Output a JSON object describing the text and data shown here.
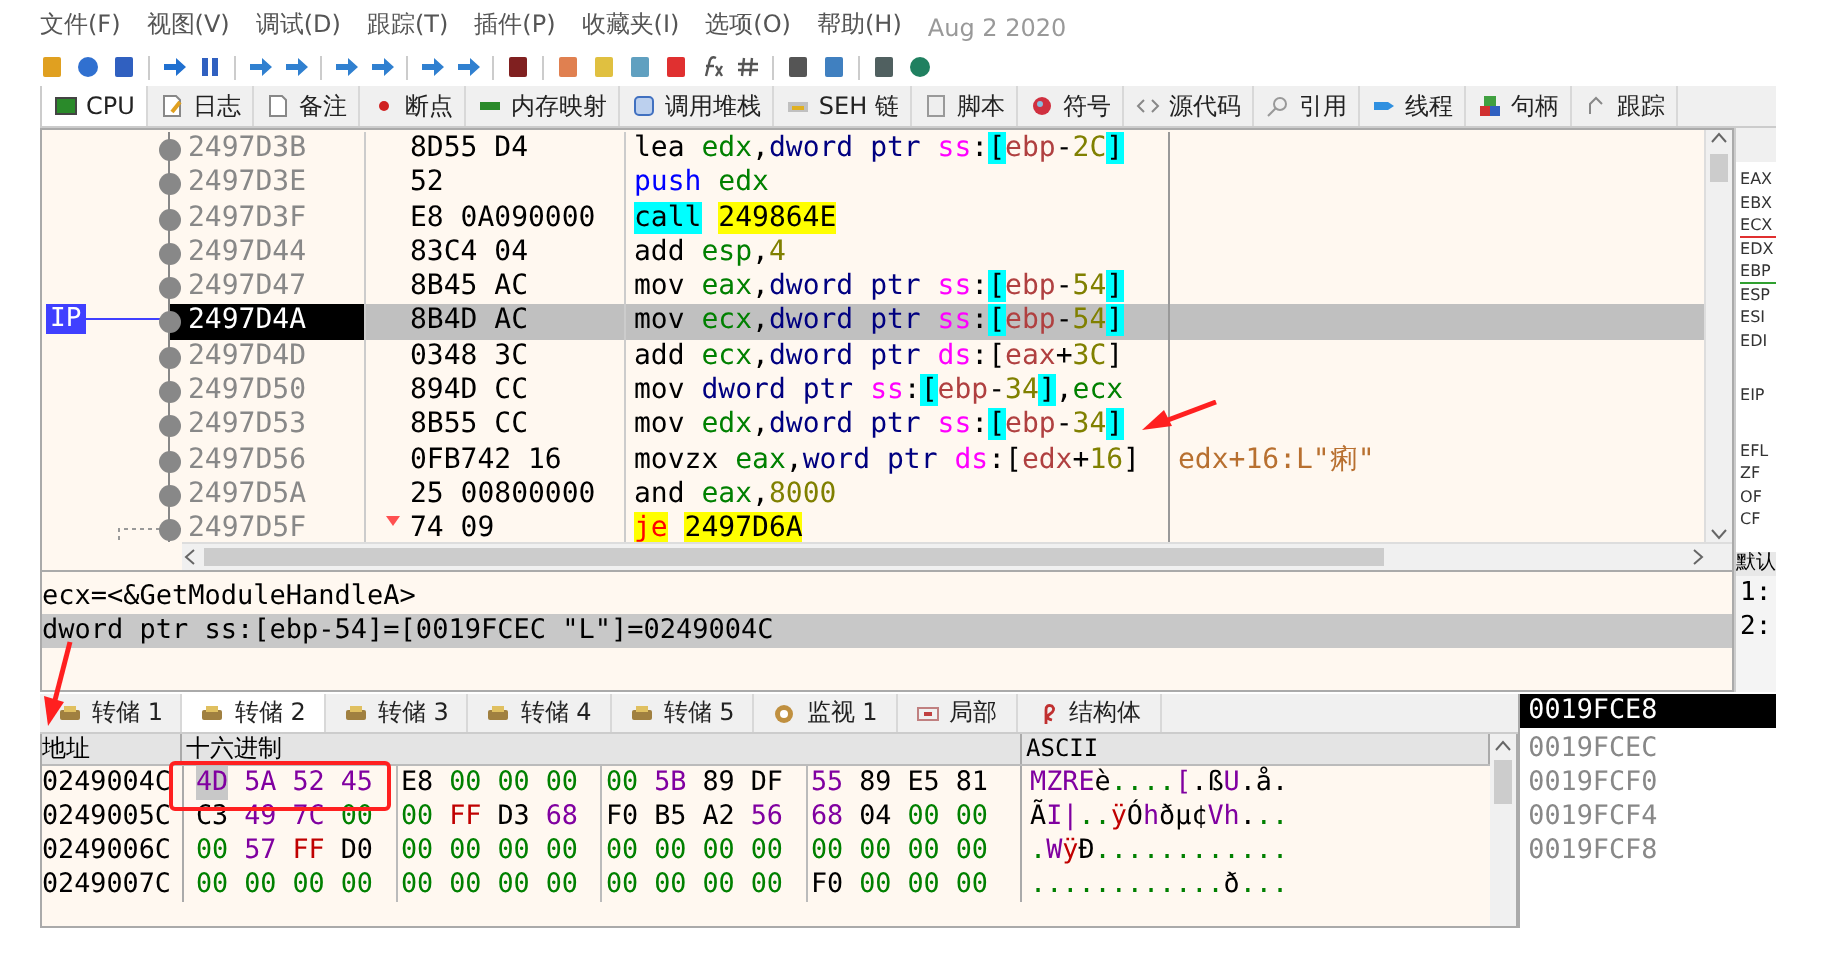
{
  "menu": [
    "文件(F)",
    "视图(V)",
    "调试(D)",
    "跟踪(T)",
    "插件(P)",
    "收藏夹(I)",
    "选项(O)",
    "帮助(H)"
  ],
  "build_date": "Aug 2 2020",
  "tabs": [
    {
      "label": "CPU",
      "selected": true
    },
    {
      "label": "日志",
      "selected": false
    },
    {
      "label": "备注",
      "selected": false
    },
    {
      "label": "断点",
      "selected": false
    },
    {
      "label": "内存映射",
      "selected": false
    },
    {
      "label": "调用堆栈",
      "selected": false
    },
    {
      "label": "SEH 链",
      "selected": false
    },
    {
      "label": "脚本",
      "selected": false
    },
    {
      "label": "符号",
      "selected": false
    },
    {
      "label": "源代码",
      "selected": false
    },
    {
      "label": "引用",
      "selected": false
    },
    {
      "label": "线程",
      "selected": false
    },
    {
      "label": "句柄",
      "selected": false
    },
    {
      "label": "跟踪",
      "selected": false
    }
  ],
  "disassembly": {
    "ip_label": "IP",
    "rows": [
      {
        "address": "2497D3B",
        "bytes": "8D55 D4",
        "instruction": "lea edx,dword ptr ss:[ebp-2C]",
        "kind": "normal",
        "selected": false
      },
      {
        "address": "2497D3E",
        "bytes": "52",
        "instruction": "push edx",
        "kind": "push",
        "selected": false
      },
      {
        "address": "2497D3F",
        "bytes": "E8 0A090000",
        "instruction": "call 249864E",
        "kind": "call",
        "selected": false
      },
      {
        "address": "2497D44",
        "bytes": "83C4 04",
        "instruction": "add esp,4",
        "kind": "normal",
        "selected": false
      },
      {
        "address": "2497D47",
        "bytes": "8B45 AC",
        "instruction": "mov eax,dword ptr ss:[ebp-54]",
        "kind": "normal",
        "selected": false
      },
      {
        "address": "2497D4A",
        "bytes": "8B4D AC",
        "instruction": "mov ecx,dword ptr ss:[ebp-54]",
        "kind": "normal",
        "selected": true
      },
      {
        "address": "2497D4D",
        "bytes": "0348 3C",
        "instruction": "add ecx,dword ptr ds:[eax+3C]",
        "kind": "normal",
        "selected": false
      },
      {
        "address": "2497D50",
        "bytes": "894D CC",
        "instruction": "mov dword ptr ss:[ebp-34],ecx",
        "kind": "normal",
        "selected": false
      },
      {
        "address": "2497D53",
        "bytes": "8B55 CC",
        "instruction": "mov edx,dword ptr ss:[ebp-34]",
        "kind": "normal",
        "selected": false
      },
      {
        "address": "2497D56",
        "bytes": "0FB742 16",
        "instruction": "movzx eax,word ptr ds:[edx+16]",
        "kind": "normal",
        "selected": false,
        "comment": "edx+16:L\"痢\""
      },
      {
        "address": "2497D5A",
        "bytes": "25 00800000",
        "instruction": "and eax,8000",
        "kind": "normal",
        "selected": false
      },
      {
        "address": "2497D5F",
        "bytes": "74 09",
        "instruction": "je 2497D6A",
        "kind": "jump",
        "selected": false
      }
    ]
  },
  "registers": [
    [
      {
        "name": "EAX"
      },
      {
        "name": "EBX"
      },
      {
        "name": "ECX",
        "color": "#e03030"
      },
      {
        "name": "EDX"
      },
      {
        "name": "EBP",
        "color": "#30a030"
      },
      {
        "name": "ESP"
      },
      {
        "name": "ESI"
      },
      {
        "name": "EDI"
      }
    ],
    [
      {
        "name": "EIP"
      }
    ],
    [
      {
        "name": "EFL"
      },
      {
        "name": "ZF"
      },
      {
        "name": "OF"
      },
      {
        "name": "CF"
      }
    ]
  ],
  "call_stack": {
    "title": "默认",
    "rows": [
      "1:",
      "2:"
    ]
  },
  "info": [
    {
      "text": "ecx=<&GetModuleHandleA>",
      "selected": false
    },
    {
      "text": "dword ptr ss:[ebp-54]=[0019FCEC \"L\"]=0249004C",
      "selected": true
    }
  ],
  "dump_tabs": [
    {
      "label": "转储 1",
      "selected": false
    },
    {
      "label": "转储 2",
      "selected": true
    },
    {
      "label": "转储 3",
      "selected": false
    },
    {
      "label": "转储 4",
      "selected": false
    },
    {
      "label": "转储 5",
      "selected": false
    },
    {
      "label": "监视 1",
      "selected": false
    },
    {
      "label": "局部",
      "selected": false
    },
    {
      "label": "结构体",
      "selected": false
    }
  ],
  "dump": {
    "columns": [
      "地址",
      "十六进制",
      "ASCII"
    ],
    "rows": [
      {
        "address": "0249004C",
        "bytes": [
          {
            "v": "4D",
            "selected": true
          },
          {
            "v": "5A",
            "selected": false
          },
          {
            "v": "52",
            "selected": false
          },
          {
            "v": "45",
            "selected": false
          },
          {
            "v": "E8",
            "selected": false
          },
          {
            "v": "00",
            "selected": false
          },
          {
            "v": "00",
            "selected": false
          },
          {
            "v": "00",
            "selected": false
          },
          {
            "v": "00",
            "selected": false
          },
          {
            "v": "5B",
            "selected": false
          },
          {
            "v": "89",
            "selected": false
          },
          {
            "v": "DF",
            "selected": false
          },
          {
            "v": "55",
            "selected": false
          },
          {
            "v": "89",
            "selected": false
          },
          {
            "v": "E5",
            "selected": false
          },
          {
            "v": "81",
            "selected": false
          }
        ],
        "ascii": "MZREè....[.ßU.å."
      },
      {
        "address": "0249005C",
        "bytes": [
          {
            "v": "C3",
            "selected": false
          },
          {
            "v": "49",
            "selected": false
          },
          {
            "v": "7C",
            "selected": false
          },
          {
            "v": "00",
            "selected": false
          },
          {
            "v": "00",
            "selected": false
          },
          {
            "v": "FF",
            "selected": false
          },
          {
            "v": "D3",
            "selected": false
          },
          {
            "v": "68",
            "selected": false
          },
          {
            "v": "F0",
            "selected": false
          },
          {
            "v": "B5",
            "selected": false
          },
          {
            "v": "A2",
            "selected": false
          },
          {
            "v": "56",
            "selected": false
          },
          {
            "v": "68",
            "selected": false
          },
          {
            "v": "04",
            "selected": false
          },
          {
            "v": "00",
            "selected": false
          },
          {
            "v": "00",
            "selected": false
          }
        ],
        "ascii": "ÃI|..ÿÓhðµ¢Vh..."
      },
      {
        "address": "0249006C",
        "bytes": [
          {
            "v": "00",
            "selected": false
          },
          {
            "v": "57",
            "selected": false
          },
          {
            "v": "FF",
            "selected": false
          },
          {
            "v": "D0",
            "selected": false
          },
          {
            "v": "00",
            "selected": false
          },
          {
            "v": "00",
            "selected": false
          },
          {
            "v": "00",
            "selected": false
          },
          {
            "v": "00",
            "selected": false
          },
          {
            "v": "00",
            "selected": false
          },
          {
            "v": "00",
            "selected": false
          },
          {
            "v": "00",
            "selected": false
          },
          {
            "v": "00",
            "selected": false
          },
          {
            "v": "00",
            "selected": false
          },
          {
            "v": "00",
            "selected": false
          },
          {
            "v": "00",
            "selected": false
          },
          {
            "v": "00",
            "selected": false
          }
        ],
        "ascii": ".WÿÐ............"
      },
      {
        "address": "0249007C",
        "bytes": [
          {
            "v": "00",
            "selected": false
          },
          {
            "v": "00",
            "selected": false
          },
          {
            "v": "00",
            "selected": false
          },
          {
            "v": "00",
            "selected": false
          },
          {
            "v": "00",
            "selected": false
          },
          {
            "v": "00",
            "selected": false
          },
          {
            "v": "00",
            "selected": false
          },
          {
            "v": "00",
            "selected": false
          },
          {
            "v": "00",
            "selected": false
          },
          {
            "v": "00",
            "selected": false
          },
          {
            "v": "00",
            "selected": false
          },
          {
            "v": "00",
            "selected": false
          },
          {
            "v": "F0",
            "selected": false
          },
          {
            "v": "00",
            "selected": false
          },
          {
            "v": "00",
            "selected": false
          },
          {
            "v": "00",
            "selected": false
          }
        ],
        "ascii": "............ð..."
      }
    ]
  },
  "stack": [
    {
      "address": "0019FCE8",
      "selected": true
    },
    {
      "address": "0019FCEC",
      "selected": false
    },
    {
      "address": "0019FCF0",
      "selected": false
    },
    {
      "address": "0019FCF4",
      "selected": false
    },
    {
      "address": "0019FCF8",
      "selected": false
    }
  ]
}
